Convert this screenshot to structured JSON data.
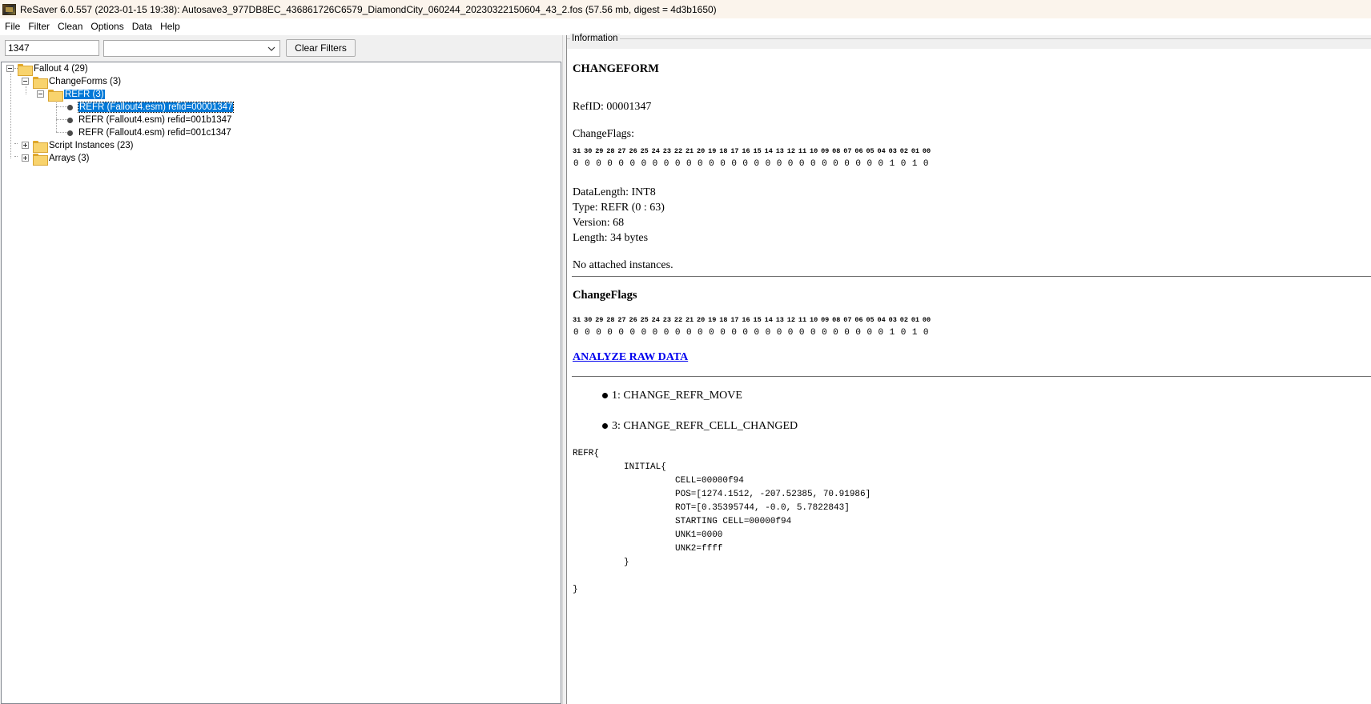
{
  "window": {
    "title": "ReSaver 6.0.557 (2023-01-15 19:38): Autosave3_977DB8EC_436861726C6579_DiamondCity_060244_20230322150604_43_2.fos (57.56 mb, digest = 4d3b1650)"
  },
  "menu": {
    "items": [
      "File",
      "Filter",
      "Clean",
      "Options",
      "Data",
      "Help"
    ]
  },
  "filter": {
    "text_value": "1347",
    "combo_value": "",
    "clear_label": "Clear Filters"
  },
  "tree": {
    "root": "Fallout 4 (29)",
    "changeforms": "ChangeForms (3)",
    "refr_group": "REFR (3)",
    "leaves": [
      "REFR (Fallout4.esm) refid=00001347",
      "REFR (Fallout4.esm) refid=001b1347",
      "REFR (Fallout4.esm) refid=001c1347"
    ],
    "script_instances": "Script Instances (23)",
    "arrays": "Arrays (3)"
  },
  "info": {
    "legend": "Information",
    "heading": "CHANGEFORM",
    "refid": "RefID: 00001347",
    "changeflags_label": "ChangeFlags:",
    "bit_headers": [
      "31",
      "30",
      "29",
      "28",
      "27",
      "26",
      "25",
      "24",
      "23",
      "22",
      "21",
      "20",
      "19",
      "18",
      "17",
      "16",
      "15",
      "14",
      "13",
      "12",
      "11",
      "10",
      "09",
      "08",
      "07",
      "06",
      "05",
      "04",
      "03",
      "02",
      "01",
      "00"
    ],
    "bit_values": [
      "0",
      "0",
      "0",
      "0",
      "0",
      "0",
      "0",
      "0",
      "0",
      "0",
      "0",
      "0",
      "0",
      "0",
      "0",
      "0",
      "0",
      "0",
      "0",
      "0",
      "0",
      "0",
      "0",
      "0",
      "0",
      "0",
      "0",
      "0",
      "1",
      "0",
      "1",
      "0"
    ],
    "data_length": "DataLength: INT8",
    "type": "Type: REFR (0 : 63)",
    "version": "Version: 68",
    "length": "Length: 34 bytes",
    "attached": "No attached instances.",
    "changeflags_heading": "ChangeFlags",
    "analyze_link": "ANALYZE RAW DATA",
    "flags_list": [
      "1: CHANGE_REFR_MOVE",
      "3: CHANGE_REFR_CELL_CHANGED"
    ],
    "code_lines": [
      "REFR{",
      "INITIAL{",
      "CELL=00000f94",
      "POS=[1274.1512, -207.52385, 70.91986]",
      "ROT=[0.35395744, -0.0, 5.7822843]",
      "STARTING CELL=00000f94",
      "UNK1=0000",
      "UNK2=ffff",
      "}",
      "}"
    ]
  }
}
